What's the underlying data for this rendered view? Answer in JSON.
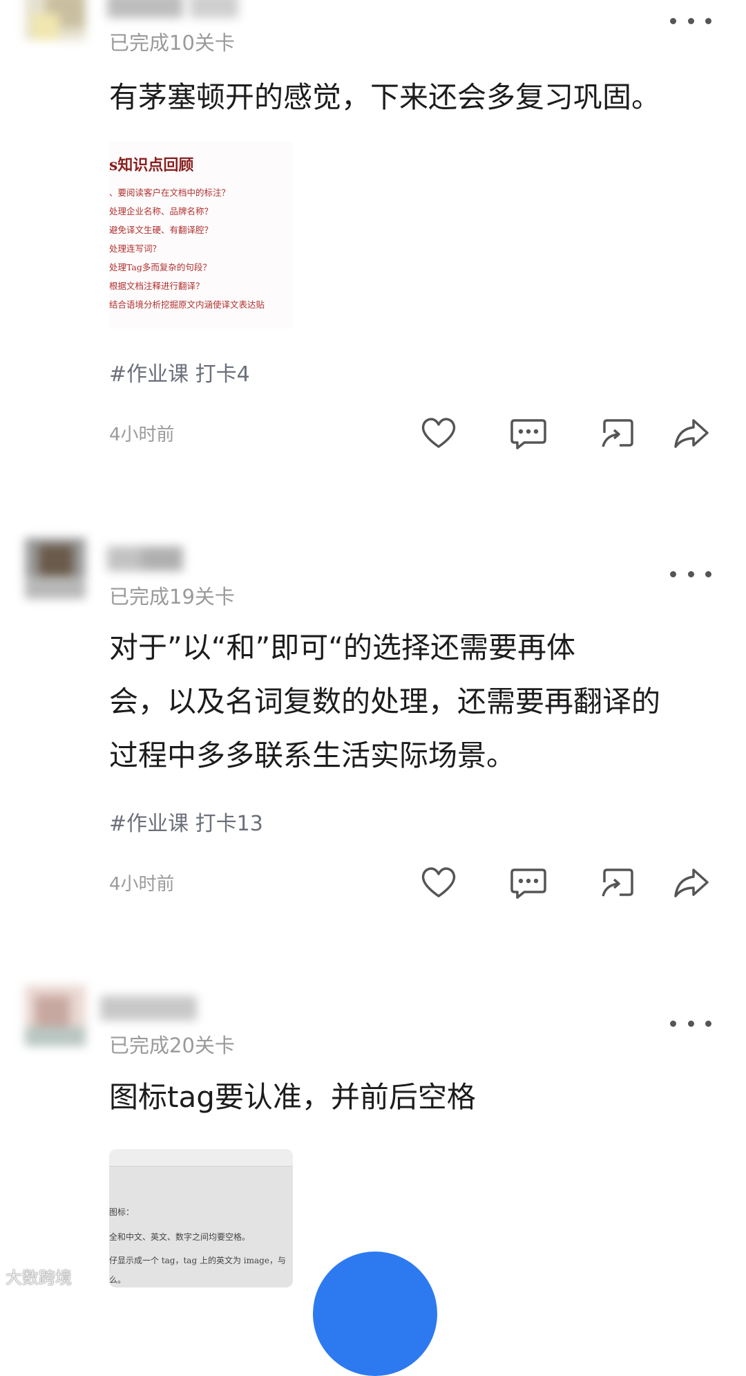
{
  "colors": {
    "accent": "#2d7af0",
    "doc_title": "#8a1f1f",
    "doc_text": "#b03030"
  },
  "posts": [
    {
      "level": "已完成10关卡",
      "content": "有茅塞顿开的感觉，下来还会多复习巩固。",
      "doc": {
        "title": "s知识点回顾",
        "lines": [
          "、要阅读客户在文档中的标注？",
          "处理企业名称、品牌名称？",
          "避免译文生硬、有翻译腔？",
          "处理连写词？",
          "处理Tag多而复杂的句段？",
          "根据文档注释进行翻译？",
          "结合语境分析挖掘原文内涵使译文表达贴"
        ]
      },
      "tag": "#作业课 打卡4",
      "time": "4小时前"
    },
    {
      "level": "已完成19关卡",
      "content": [
        "对于”以“和”即可“的选择还需要再体",
        "会，以及名词复数的处理，还需要再翻译的",
        "过程中多多联系生活实际场景。"
      ],
      "tag": "#作业课 打卡13",
      "time": "4小时前"
    },
    {
      "level": "已完成20关卡",
      "content": "图标tag要认准，并前后空格",
      "doc": {
        "lines": [
          "图标：",
          "全和中文、英文、数字之间均要空格。",
          "仔显示成一个 tag，tag 上的英文为 image，与",
          "么。"
        ]
      }
    }
  ],
  "icons": [
    "more-icon",
    "heart-icon",
    "comment-icon",
    "repost-icon",
    "share-icon"
  ],
  "watermark": "大数跨境"
}
